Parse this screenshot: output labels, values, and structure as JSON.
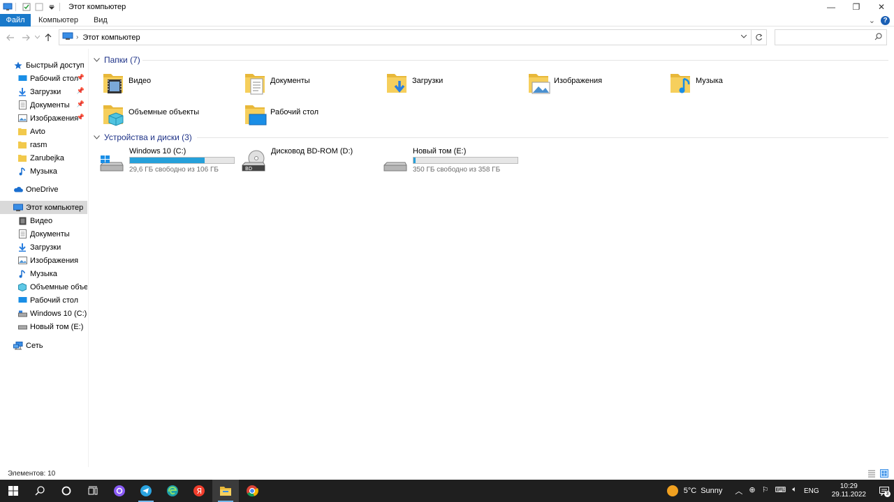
{
  "window": {
    "title": "Этот компьютер",
    "minimize": "—",
    "restore": "❐",
    "close": "✕"
  },
  "ribbon": {
    "tabs": [
      "Файл",
      "Компьютер",
      "Вид"
    ],
    "expand": "⌄",
    "help": "?"
  },
  "address": {
    "path": "Этот компьютер",
    "separator": "›",
    "search_placeholder": ""
  },
  "sidebar": {
    "quick_access": "Быстрый доступ",
    "quick_items": [
      {
        "label": "Рабочий стол",
        "icon": "desktop-icon",
        "pinned": true
      },
      {
        "label": "Загрузки",
        "icon": "download-icon",
        "pinned": true
      },
      {
        "label": "Документы",
        "icon": "document-icon",
        "pinned": true
      },
      {
        "label": "Изображения",
        "icon": "pictures-icon",
        "pinned": true
      },
      {
        "label": "Avto",
        "icon": "folder-icon",
        "pinned": false
      },
      {
        "label": "rasm",
        "icon": "folder-icon",
        "pinned": false
      },
      {
        "label": "Zarubejka",
        "icon": "folder-icon",
        "pinned": false
      },
      {
        "label": "Музыка",
        "icon": "music-icon",
        "pinned": false
      }
    ],
    "onedrive": "OneDrive",
    "this_pc": "Этот компьютер",
    "pc_items": [
      {
        "label": "Видео",
        "icon": "video-icon"
      },
      {
        "label": "Документы",
        "icon": "document-icon"
      },
      {
        "label": "Загрузки",
        "icon": "download-icon"
      },
      {
        "label": "Изображения",
        "icon": "pictures-icon"
      },
      {
        "label": "Музыка",
        "icon": "music-icon"
      },
      {
        "label": "Объемные объекты",
        "icon": "3d-objects-icon"
      },
      {
        "label": "Рабочий стол",
        "icon": "desktop-icon"
      },
      {
        "label": "Windows 10 (C:)",
        "icon": "drive-icon"
      },
      {
        "label": "Новый том (E:)",
        "icon": "drive-icon"
      }
    ],
    "network": "Сеть"
  },
  "main": {
    "folders_header": "Папки (7)",
    "folders": [
      {
        "label": "Видео",
        "icon": "video-folder-icon"
      },
      {
        "label": "Документы",
        "icon": "documents-folder-icon"
      },
      {
        "label": "Загрузки",
        "icon": "downloads-folder-icon"
      },
      {
        "label": "Изображения",
        "icon": "pictures-folder-icon"
      },
      {
        "label": "Музыка",
        "icon": "music-folder-icon"
      },
      {
        "label": "Объемные объекты",
        "icon": "3d-objects-folder-icon"
      },
      {
        "label": "Рабочий стол",
        "icon": "desktop-folder-icon"
      }
    ],
    "drives_header": "Устройства и диски (3)",
    "drives": [
      {
        "name": "Windows 10 (C:)",
        "free_text": "29,6 ГБ свободно из 106 ГБ",
        "used_fraction": 0.72,
        "icon": "windows-drive-icon"
      },
      {
        "name": "Дисковод BD-ROM (D:)",
        "free_text": "",
        "used_fraction": null,
        "icon": "bd-rom-icon"
      },
      {
        "name": "Новый том (E:)",
        "free_text": "350 ГБ свободно из 358 ГБ",
        "used_fraction": 0.02,
        "icon": "drive-icon"
      }
    ]
  },
  "status": {
    "items_count": "Элементов: 10"
  },
  "taskbar": {
    "weather_temp": "5°C",
    "weather_text": "Sunny",
    "lang": "ENG",
    "time": "10:29",
    "date": "29.11.2022",
    "notifications": "3"
  },
  "colors": {
    "accent": "#1979ca",
    "bar_fill": "#26a0da",
    "folder_yellow": "#f2c94c",
    "taskbar_bg": "#1f1f1f"
  }
}
